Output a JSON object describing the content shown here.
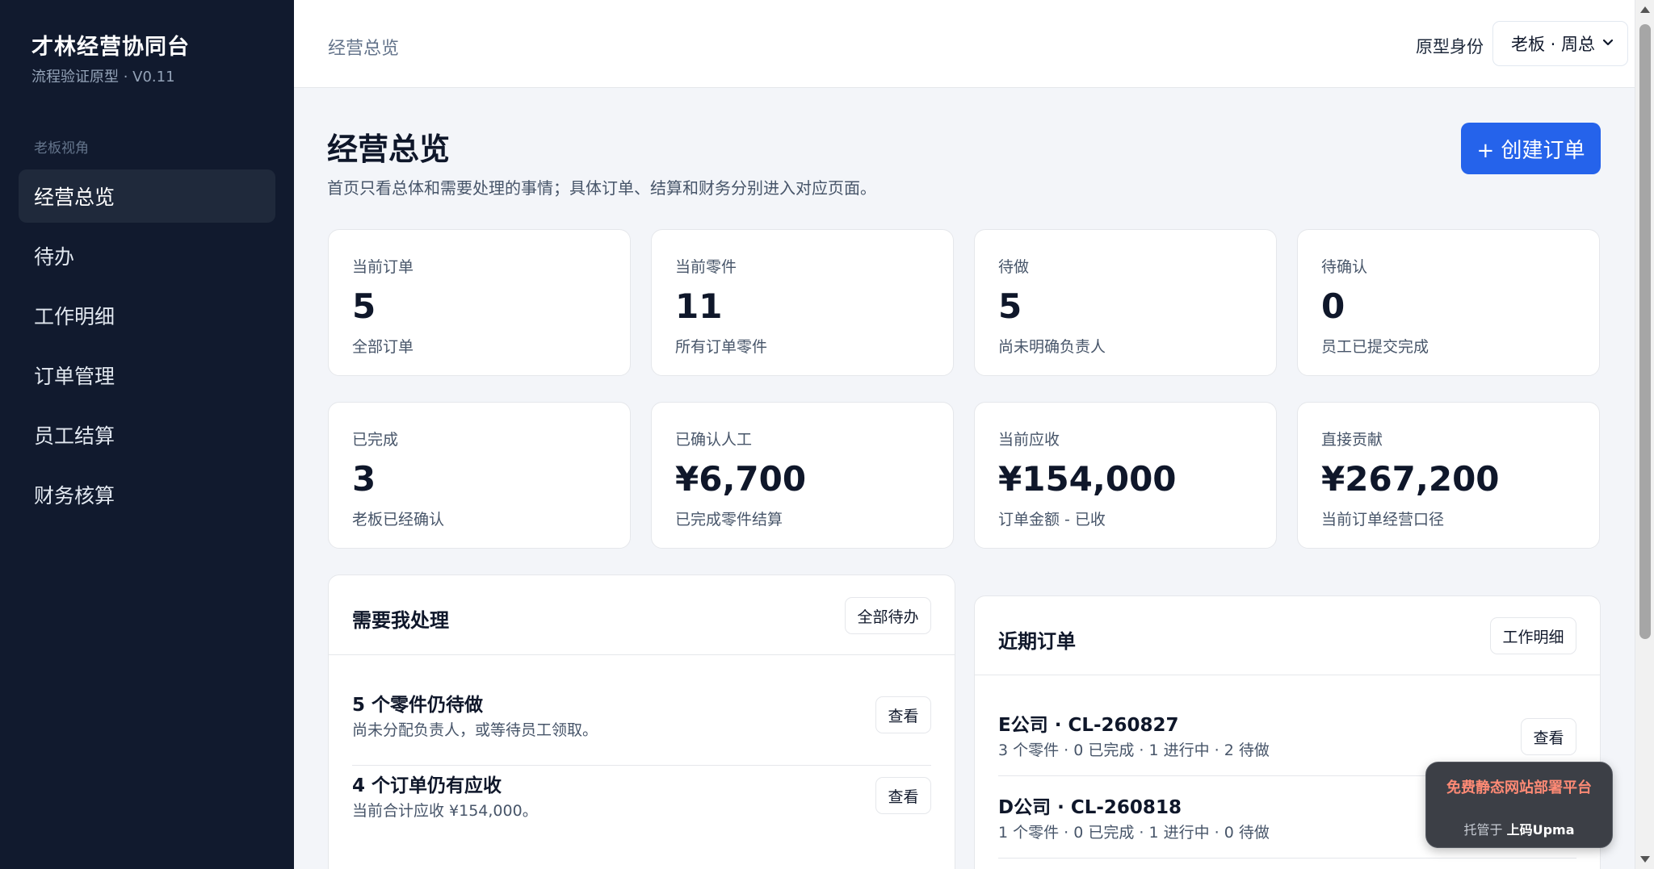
{
  "sidebar": {
    "brand_title": "才林经营协同台",
    "brand_sub": "流程验证原型 · V0.11",
    "section_label": "老板视角",
    "items": [
      {
        "label": "经营总览"
      },
      {
        "label": "待办"
      },
      {
        "label": "工作明细"
      },
      {
        "label": "订单管理"
      },
      {
        "label": "员工结算"
      },
      {
        "label": "财务核算"
      }
    ],
    "active_index": 0
  },
  "topbar": {
    "breadcrumb": "经营总览",
    "role_label": "原型身份",
    "role_value": "老板 · 周总"
  },
  "page": {
    "title": "经营总览",
    "description": "首页只看总体和需要处理的事情；具体订单、结算和财务分别进入对应页面。",
    "create_button": "+ 创建订单"
  },
  "stats": [
    {
      "label": "当前订单",
      "value": "5",
      "note": "全部订单"
    },
    {
      "label": "当前零件",
      "value": "11",
      "note": "所有订单零件"
    },
    {
      "label": "待做",
      "value": "5",
      "note": "尚未明确负责人"
    },
    {
      "label": "待确认",
      "value": "0",
      "note": "员工已提交完成"
    },
    {
      "label": "已完成",
      "value": "3",
      "note": "老板已经确认"
    },
    {
      "label": "已确认人工",
      "value": "¥6,700",
      "note": "已完成零件结算"
    },
    {
      "label": "当前应收",
      "value": "¥154,000",
      "note": "订单金额 - 已收"
    },
    {
      "label": "直接贡献",
      "value": "¥267,200",
      "note": "当前订单经营口径"
    }
  ],
  "todo_panel": {
    "title": "需要我处理",
    "header_button": "全部待办",
    "items": [
      {
        "title": "5 个零件仍待做",
        "sub": "尚未分配负责人，或等待员工领取。",
        "button": "查看"
      },
      {
        "title": "4 个订单仍有应收",
        "sub": "当前合计应收 ¥154,000。",
        "button": "查看"
      }
    ]
  },
  "orders_panel": {
    "title": "近期订单",
    "header_button": "工作明细",
    "items": [
      {
        "title": "E公司 · CL-260827",
        "sub": "3 个零件 · 0 已完成 · 1 进行中 · 2 待做",
        "button": "查看"
      },
      {
        "title": "D公司 · CL-260818",
        "sub": "1 个零件 · 0 已完成 · 1 进行中 · 0 待做"
      }
    ]
  },
  "promo": {
    "main": "免费静态网站部署平台",
    "sub_prefix": "托管于",
    "sub_brand": "上码Upma"
  },
  "colors": {
    "sidebar_bg": "#111a2e",
    "accent": "#2563eb",
    "page_bg": "#f3f5f9"
  }
}
